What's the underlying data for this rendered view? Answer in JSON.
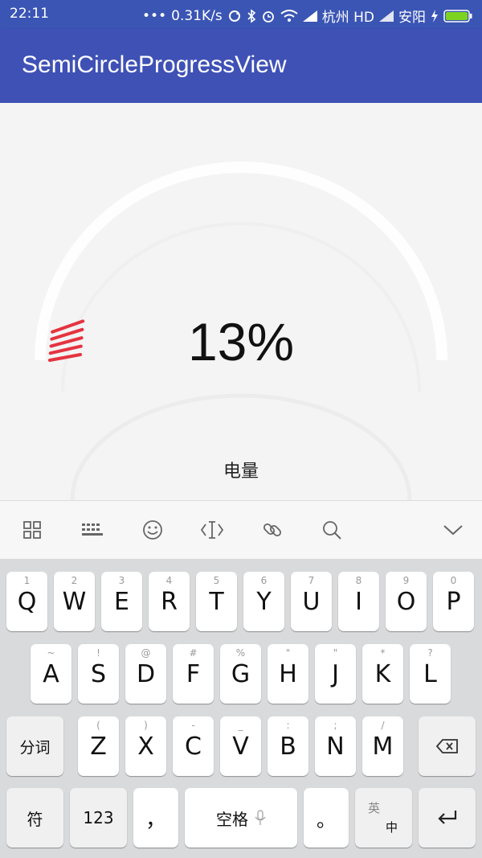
{
  "status_bar": {
    "time": "22:11",
    "dots": "•••",
    "speed": "0.31K/s",
    "carrier1": "杭州 HD",
    "carrier2": "安阳"
  },
  "app_bar": {
    "title": "SemiCircleProgressView"
  },
  "progress": {
    "value_percent": 13,
    "label": "13%",
    "caption": "电量",
    "progress_color": "#e53340",
    "track_color": "#eeeeee"
  },
  "keyboard_toolbar": {
    "icons": [
      "grid-icon",
      "keyboard-icon",
      "emoji-icon",
      "cursor-icon",
      "link-icon",
      "search-icon",
      "chevron-down-icon"
    ]
  },
  "keyboard": {
    "row1": [
      {
        "hint": "1",
        "key": "Q"
      },
      {
        "hint": "2",
        "key": "W"
      },
      {
        "hint": "3",
        "key": "E"
      },
      {
        "hint": "4",
        "key": "R"
      },
      {
        "hint": "5",
        "key": "T"
      },
      {
        "hint": "6",
        "key": "Y"
      },
      {
        "hint": "7",
        "key": "U"
      },
      {
        "hint": "8",
        "key": "I"
      },
      {
        "hint": "9",
        "key": "O"
      },
      {
        "hint": "0",
        "key": "P"
      }
    ],
    "row2": [
      {
        "hint": "~",
        "key": "A"
      },
      {
        "hint": "!",
        "key": "S"
      },
      {
        "hint": "@",
        "key": "D"
      },
      {
        "hint": "#",
        "key": "F"
      },
      {
        "hint": "%",
        "key": "G"
      },
      {
        "hint": "\"",
        "key": "H"
      },
      {
        "hint": "\"",
        "key": "J"
      },
      {
        "hint": "*",
        "key": "K"
      },
      {
        "hint": "?",
        "key": "L"
      }
    ],
    "row3": [
      {
        "hint": "(",
        "key": "Z"
      },
      {
        "hint": ")",
        "key": "X"
      },
      {
        "hint": "-",
        "key": "C"
      },
      {
        "hint": "_",
        "key": "V"
      },
      {
        "hint": ":",
        "key": "B"
      },
      {
        "hint": ";",
        "key": "N"
      },
      {
        "hint": "/",
        "key": "M"
      }
    ],
    "fenci": "分词",
    "fu": "符",
    "num": "123",
    "comma": "，",
    "space": "空格",
    "period": "。",
    "lang_top": "英",
    "lang_bottom": "中"
  }
}
